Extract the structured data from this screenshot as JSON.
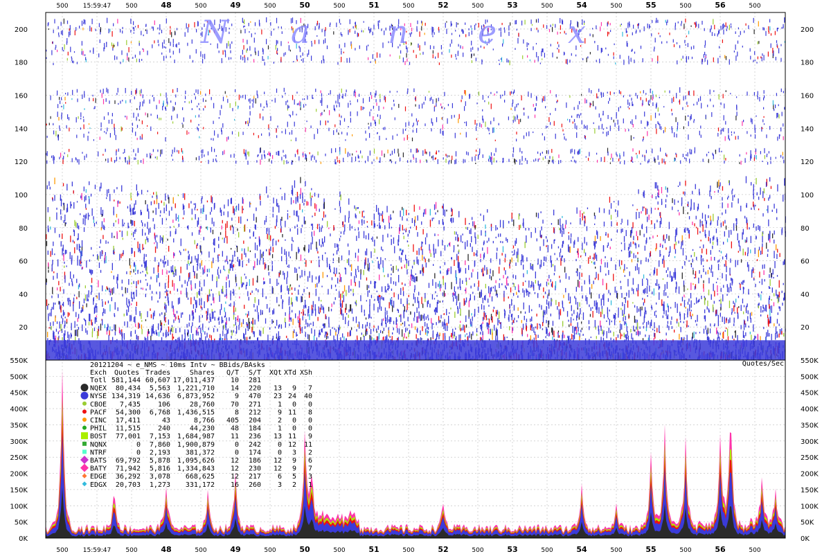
{
  "colors": {
    "NQEX": "#2a2a2a",
    "NYSE": "#3b3bd9",
    "CBOE": "#9acd32",
    "PACF": "#ee1111",
    "CINC": "#ff9900",
    "PHIL": "#22aa22",
    "BOST": "#aaee00",
    "NQNX": "#33aa33",
    "NTRF": "#55ffcc",
    "BATS": "#cc33cc",
    "BATY": "#ff33aa",
    "EDGE": "#ff7733",
    "EDGX": "#33bbdd"
  },
  "watermark": [
    "N",
    "a",
    "n",
    "e",
    "x"
  ],
  "chart_data": [
    {
      "type": "scatter",
      "title": "",
      "xlabel": "",
      "ylabel": "",
      "x_ticks_top": [
        "500",
        "15:59:47",
        "500",
        "48",
        "500",
        "49",
        "500",
        "50",
        "500",
        "51",
        "500",
        "52",
        "500",
        "53",
        "500",
        "54",
        "500",
        "55",
        "500",
        "56",
        "500"
      ],
      "y_ticks": [
        "200",
        "180",
        "160",
        "140",
        "120",
        "100",
        "80",
        "60",
        "40",
        "20"
      ],
      "ylim": [
        0,
        210
      ],
      "grid": true,
      "series_colors": [
        "#3b3bd9",
        "#ee1111",
        "#2a2a2a",
        "#9acd32",
        "#ff33aa",
        "#33bbdd",
        "#ff9900"
      ],
      "density_profile": [
        {
          "x": "15:59:47",
          "y_top": 108
        },
        {
          "x": "48",
          "y_top": 100
        },
        {
          "x": "49",
          "y_top": 95
        },
        {
          "x": "50",
          "y_top": 108
        },
        {
          "x": "51",
          "y_top": 90
        },
        {
          "x": "52",
          "y_top": 92
        },
        {
          "x": "53",
          "y_top": 88
        },
        {
          "x": "54",
          "y_top": 90
        },
        {
          "x": "55",
          "y_top": 105
        },
        {
          "x": "56",
          "y_top": 108
        }
      ]
    },
    {
      "type": "area",
      "title": "20121204 ~ e_NMS ~ 10ms Intv ~ BBids/BAsks",
      "ylabel": "Quotes/Sec",
      "x_ticks_bottom": [
        "500",
        "15:59:47",
        "500",
        "48",
        "500",
        "49",
        "500",
        "50",
        "500",
        "51",
        "500",
        "52",
        "500",
        "53",
        "500",
        "54",
        "500",
        "55",
        "500",
        "56",
        "500"
      ],
      "y_ticks": [
        "550K",
        "500K",
        "450K",
        "400K",
        "350K",
        "300K",
        "250K",
        "200K",
        "150K",
        "100K",
        "50K",
        "0K"
      ],
      "ylim": [
        0,
        550000
      ],
      "baseline": 30000,
      "spikes": [
        {
          "x": "15:59:46.5",
          "y": 500000
        },
        {
          "x": "15:59:47.25",
          "y": 130000
        },
        {
          "x": "15:59:48",
          "y": 140000
        },
        {
          "x": "15:59:48.6",
          "y": 110000
        },
        {
          "x": "15:59:49",
          "y": 175000
        },
        {
          "x": "15:59:50",
          "y": 285000
        },
        {
          "x": "15:59:50.1",
          "y": 130000
        },
        {
          "x": "15:59:52",
          "y": 80000
        },
        {
          "x": "15:59:54",
          "y": 140000
        },
        {
          "x": "15:59:54.5",
          "y": 70000
        },
        {
          "x": "15:59:55",
          "y": 245000
        },
        {
          "x": "15:59:55.2",
          "y": 290000
        },
        {
          "x": "15:59:55.5",
          "y": 260000
        },
        {
          "x": "15:59:56",
          "y": 270000
        },
        {
          "x": "15:59:56.15",
          "y": 395000
        },
        {
          "x": "15:59:56.6",
          "y": 155000
        },
        {
          "x": "15:59:56.8",
          "y": 110000
        }
      ],
      "table": {
        "headers": [
          "Exch",
          "Quotes",
          "Trades",
          "Shares",
          "Q/T",
          "S/T",
          "XQt",
          "XTd",
          "XSh"
        ],
        "rows": [
          {
            "exch": "Totl",
            "quotes": "581,144",
            "trades": "60,607",
            "shares": "17,011,437",
            "qt": "10",
            "st": "281",
            "xqt": "",
            "xtd": "",
            "xsh": "",
            "marker": "none"
          },
          {
            "exch": "NQEX",
            "quotes": "80,434",
            "trades": "5,563",
            "shares": "1,221,710",
            "qt": "14",
            "st": "220",
            "xqt": "13",
            "xtd": "9",
            "xsh": "7",
            "marker": "circle-lg"
          },
          {
            "exch": "NYSE",
            "quotes": "134,319",
            "trades": "14,636",
            "shares": "6,873,952",
            "qt": "9",
            "st": "470",
            "xqt": "23",
            "xtd": "24",
            "xsh": "40",
            "marker": "circle-lg"
          },
          {
            "exch": "CBOE",
            "quotes": "7,435",
            "trades": "106",
            "shares": "28,760",
            "qt": "70",
            "st": "271",
            "xqt": "1",
            "xtd": "0",
            "xsh": "0",
            "marker": "circle"
          },
          {
            "exch": "PACF",
            "quotes": "54,300",
            "trades": "6,768",
            "shares": "1,436,515",
            "qt": "8",
            "st": "212",
            "xqt": "9",
            "xtd": "11",
            "xsh": "8",
            "marker": "circle"
          },
          {
            "exch": "CINC",
            "quotes": "17,411",
            "trades": "43",
            "shares": "8,766",
            "qt": "405",
            "st": "204",
            "xqt": "2",
            "xtd": "0",
            "xsh": "0",
            "marker": "circle"
          },
          {
            "exch": "PHIL",
            "quotes": "11,515",
            "trades": "240",
            "shares": "44,230",
            "qt": "48",
            "st": "184",
            "xqt": "1",
            "xtd": "0",
            "xsh": "0",
            "marker": "circle"
          },
          {
            "exch": "BOST",
            "quotes": "77,001",
            "trades": "7,153",
            "shares": "1,684,987",
            "qt": "11",
            "st": "236",
            "xqt": "13",
            "xtd": "11",
            "xsh": "9",
            "marker": "square-lg"
          },
          {
            "exch": "NQNX",
            "quotes": "0",
            "trades": "7,860",
            "shares": "1,900,879",
            "qt": "0",
            "st": "242",
            "xqt": "0",
            "xtd": "12",
            "xsh": "11",
            "marker": "square"
          },
          {
            "exch": "NTRF",
            "quotes": "0",
            "trades": "2,193",
            "shares": "381,372",
            "qt": "0",
            "st": "174",
            "xqt": "0",
            "xtd": "3",
            "xsh": "2",
            "marker": "square"
          },
          {
            "exch": "BATS",
            "quotes": "69,792",
            "trades": "5,878",
            "shares": "1,095,626",
            "qt": "12",
            "st": "186",
            "xqt": "12",
            "xtd": "9",
            "xsh": "6",
            "marker": "diamond-lg"
          },
          {
            "exch": "BATY",
            "quotes": "71,942",
            "trades": "5,816",
            "shares": "1,334,843",
            "qt": "12",
            "st": "230",
            "xqt": "12",
            "xtd": "9",
            "xsh": "7",
            "marker": "diamond-lg"
          },
          {
            "exch": "EDGE",
            "quotes": "36,292",
            "trades": "3,078",
            "shares": "668,625",
            "qt": "12",
            "st": "217",
            "xqt": "6",
            "xtd": "5",
            "xsh": "3",
            "marker": "diamond"
          },
          {
            "exch": "EDGX",
            "quotes": "20,703",
            "trades": "1,273",
            "shares": "331,172",
            "qt": "16",
            "st": "260",
            "xqt": "3",
            "xtd": "2",
            "xsh": "1",
            "marker": "diamond"
          }
        ]
      }
    }
  ]
}
